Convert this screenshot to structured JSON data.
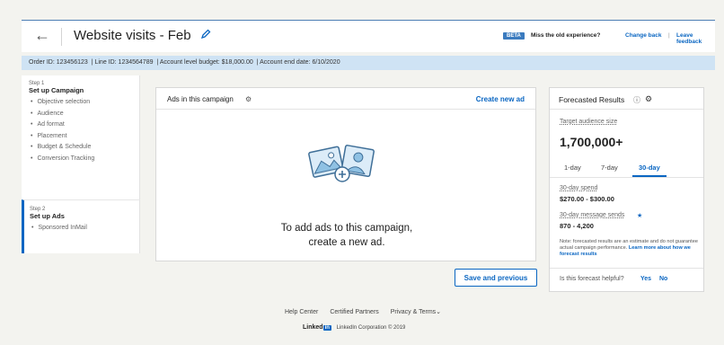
{
  "header": {
    "title": "Website visits - Feb",
    "beta_badge": "BETA",
    "miss_text": "Miss the old experience?",
    "change_back": "Change back",
    "separator": "|",
    "leave_feedback": "Leave feedback"
  },
  "infobar": {
    "order_id": "Order ID: 123456123",
    "line_id": "| Line ID: 1234564789",
    "budget": "| Account level budget: $18,000.00",
    "end_date": "| Account end date: 6/10/2020"
  },
  "sidebar": {
    "step1": {
      "label": "Step 1",
      "title": "Set up Campaign",
      "items": [
        "Objective selection",
        "Audience",
        "Ad format",
        "Placement",
        "Budget & Schedule",
        "Conversion Tracking"
      ]
    },
    "step2": {
      "label": "Step 2",
      "title": "Set up Ads",
      "items": [
        "Sponsored InMail"
      ]
    }
  },
  "ads_card": {
    "title": "Ads in this campaign",
    "create_button": "Create new ad",
    "empty_line1": "To add ads to this campaign,",
    "empty_line2": "create a new ad."
  },
  "save_button": "Save and previous",
  "forecast": {
    "title": "Forecasted Results",
    "audience_label": "Target audience size",
    "audience_value": "1,700,000+",
    "tabs": [
      "1-day",
      "7-day",
      "30-day"
    ],
    "active_tab": "30-day",
    "spend_label": "30-day spend",
    "spend_value": "$270.00 - $300.00",
    "sends_label": "30-day message sends",
    "sends_value": "870 - 4,200",
    "note": "Note: forecasted results are an estimate and do not guarantee actual campaign performance.",
    "note_link": "Learn more about how we forecast results",
    "helpful_question": "Is this forecast helpful?",
    "yes": "Yes",
    "no": "No"
  },
  "footer": {
    "links": [
      "Help Center",
      "Certified Partners",
      "Privacy & Terms"
    ],
    "logo_word": "Linked",
    "logo_box": "in",
    "copyright": "LinkedIn Corporation © 2019"
  },
  "colors": {
    "accent": "#0a66c2",
    "infobar_bg": "#cfe3f4",
    "page_bg": "#f3f3ef"
  }
}
